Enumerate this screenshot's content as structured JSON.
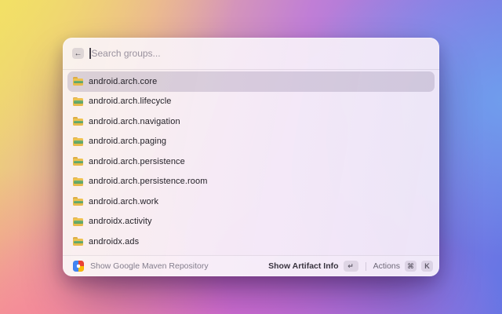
{
  "window": {
    "search": {
      "back_icon": "←",
      "placeholder": "Search groups...",
      "value": ""
    },
    "list": {
      "items": [
        {
          "label": "android.arch.core",
          "selected": true
        },
        {
          "label": "android.arch.lifecycle",
          "selected": false
        },
        {
          "label": "android.arch.navigation",
          "selected": false
        },
        {
          "label": "android.arch.paging",
          "selected": false
        },
        {
          "label": "android.arch.persistence",
          "selected": false
        },
        {
          "label": "android.arch.persistence.room",
          "selected": false
        },
        {
          "label": "android.arch.work",
          "selected": false
        },
        {
          "label": "androidx.activity",
          "selected": false
        },
        {
          "label": "androidx.ads",
          "selected": false
        }
      ],
      "item_icon": "folder-icon"
    },
    "footer": {
      "left_icon": "google-maven-extension-icon",
      "left_label": "Show Google Maven Repository",
      "primary_action": "Show Artifact Info",
      "primary_key": "↵",
      "actions_label": "Actions",
      "cmd_key": "⌘",
      "k_key": "K"
    }
  },
  "colors": {
    "selected_row": "rgba(132,120,150,0.27)",
    "folder_yellow": "#eec24f",
    "folder_green": "#64a96a",
    "ext_icon_red": "#ea4335",
    "ext_icon_yellow": "#fbbc05",
    "ext_icon_blue": "#4285f4",
    "background_gradient": [
      "#eeda6f",
      "#e9ab9f",
      "#c07ed6",
      "#8f79e3",
      "#6376e4"
    ]
  }
}
